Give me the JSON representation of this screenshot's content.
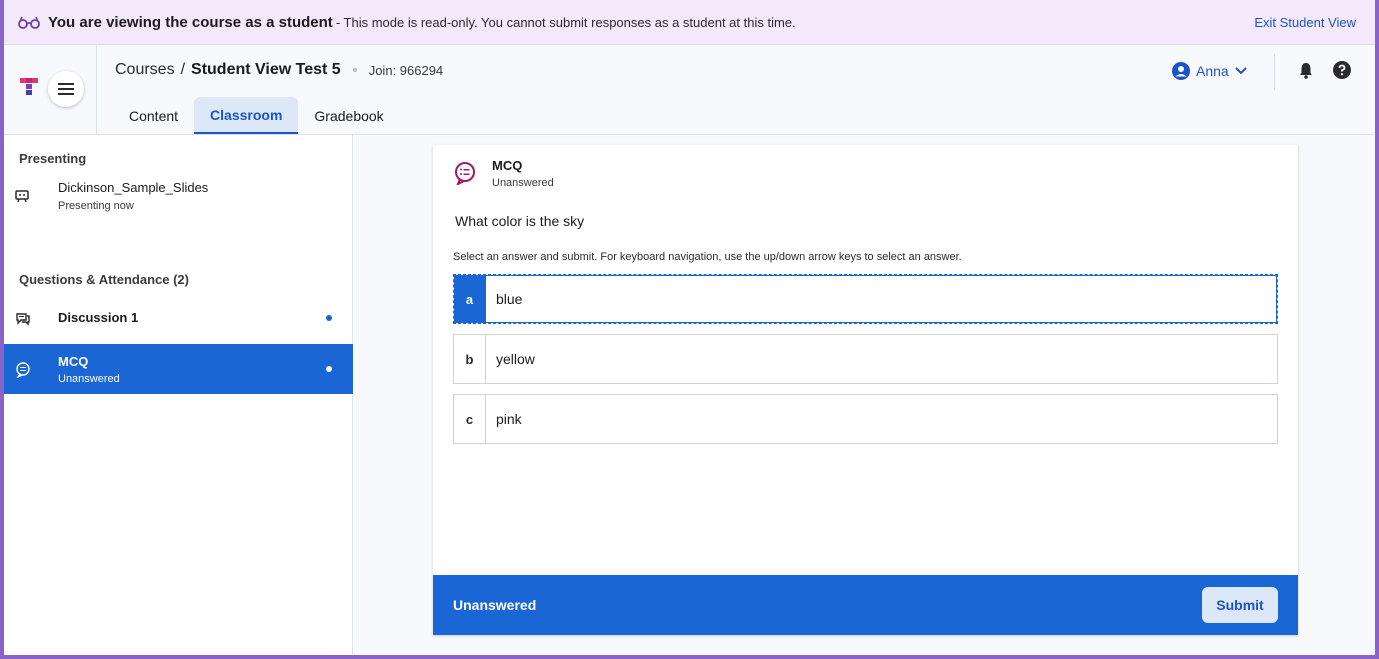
{
  "banner": {
    "strong": "You are viewing the course as a student",
    "rest": "- This mode is read-only. You cannot submit responses as a student at this time.",
    "exit_label": "Exit Student View",
    "icon": "glasses-icon"
  },
  "header": {
    "breadcrumb_courses": "Courses",
    "breadcrumb_sep": "/",
    "course_title": "Student View Test 5",
    "join": "Join: 966294",
    "user_name": "Anna",
    "tabs": [
      {
        "label": "Content"
      },
      {
        "label": "Classroom",
        "active": true
      },
      {
        "label": "Gradebook"
      }
    ]
  },
  "sidebar": {
    "presenting_title": "Presenting",
    "presentation": {
      "name": "Dickinson_Sample_Slides",
      "status": "Presenting now"
    },
    "questions_title": "Questions & Attendance (2)",
    "items": [
      {
        "label": "Discussion 1",
        "sub": ""
      },
      {
        "label": "MCQ",
        "sub": "Unanswered",
        "active": true
      }
    ]
  },
  "question": {
    "type": "MCQ",
    "status": "Unanswered",
    "text": "What color is the sky",
    "instructions": "Select an answer and submit. For keyboard navigation, use the up/down arrow keys to select an answer.",
    "options": [
      {
        "letter": "a",
        "label": "blue"
      },
      {
        "letter": "b",
        "label": "yellow"
      },
      {
        "letter": "c",
        "label": "pink"
      }
    ],
    "footer_status": "Unanswered",
    "submit_label": "Submit"
  },
  "colors": {
    "accent": "#1a66d4",
    "banner_bg": "#f4e8fb",
    "brand_purple": "#8a63c8"
  }
}
